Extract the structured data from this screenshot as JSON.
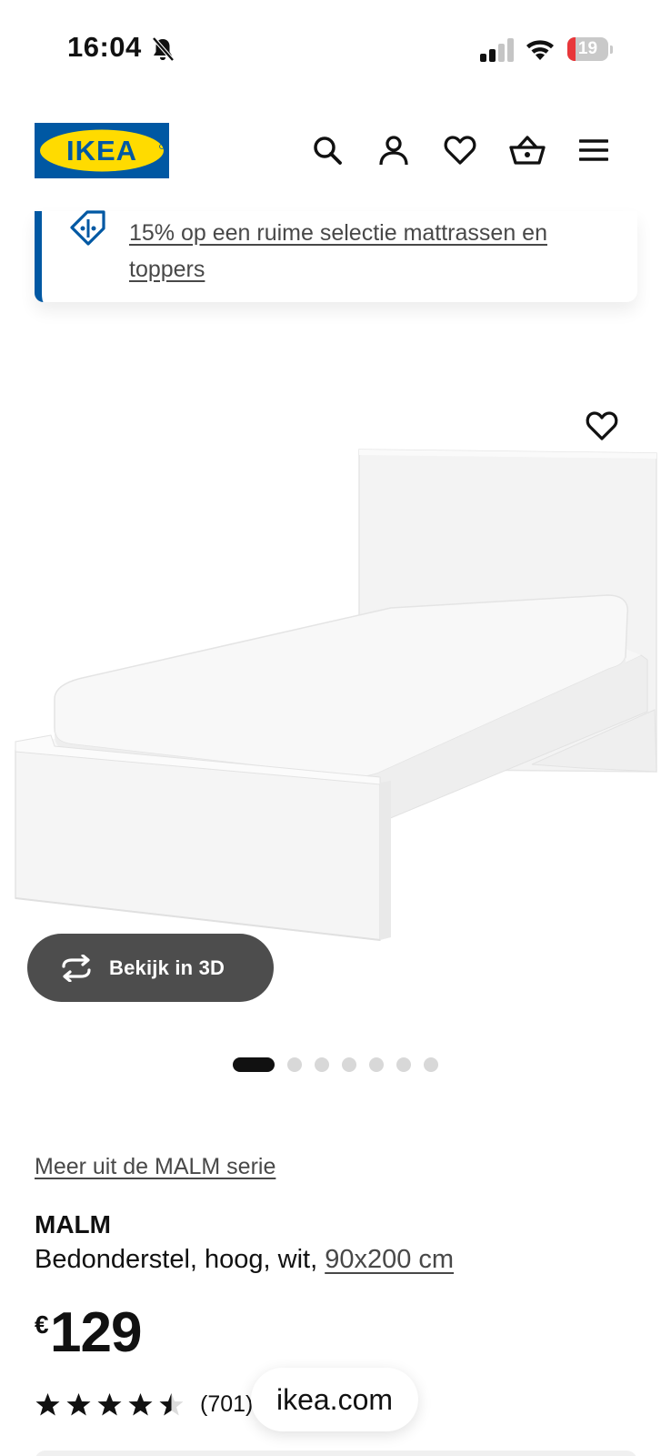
{
  "status_bar": {
    "time": "16:04",
    "battery_level": "19",
    "battery_fraction": 0.19,
    "icons": [
      "bell-slash-icon",
      "cellular-signal-icon",
      "wifi-icon",
      "battery-icon"
    ]
  },
  "header": {
    "logo_text": "IKEA",
    "icons": [
      "search-icon",
      "account-icon",
      "heart-icon",
      "basket-icon",
      "menu-icon"
    ]
  },
  "promo": {
    "icon": "price-tag-icon",
    "link_text": "15% op een ruime selectie mattrassen en toppers"
  },
  "product_image": {
    "alt": "MALM bed white",
    "favorite_icon": "heart-icon"
  },
  "view3d": {
    "icon": "rotate-3d-icon",
    "label": "Bekijk in 3D"
  },
  "gallery": {
    "total": 7,
    "active_index": 0
  },
  "product": {
    "series_link": "Meer uit de MALM serie",
    "name": "MALM",
    "desc_prefix": "Bedonderstel, hoog, wit, ",
    "size_link": "90x200 cm",
    "price_currency": "€",
    "price": "129",
    "rating_value": 4.5,
    "rating_max": 5,
    "review_count": "(701)"
  },
  "browser": {
    "url": "ikea.com"
  },
  "colors": {
    "ikea_blue": "#0058a3",
    "ikea_yellow": "#ffdb00",
    "button_dark": "#4d4d4d",
    "battery_red": "#e8373a"
  }
}
